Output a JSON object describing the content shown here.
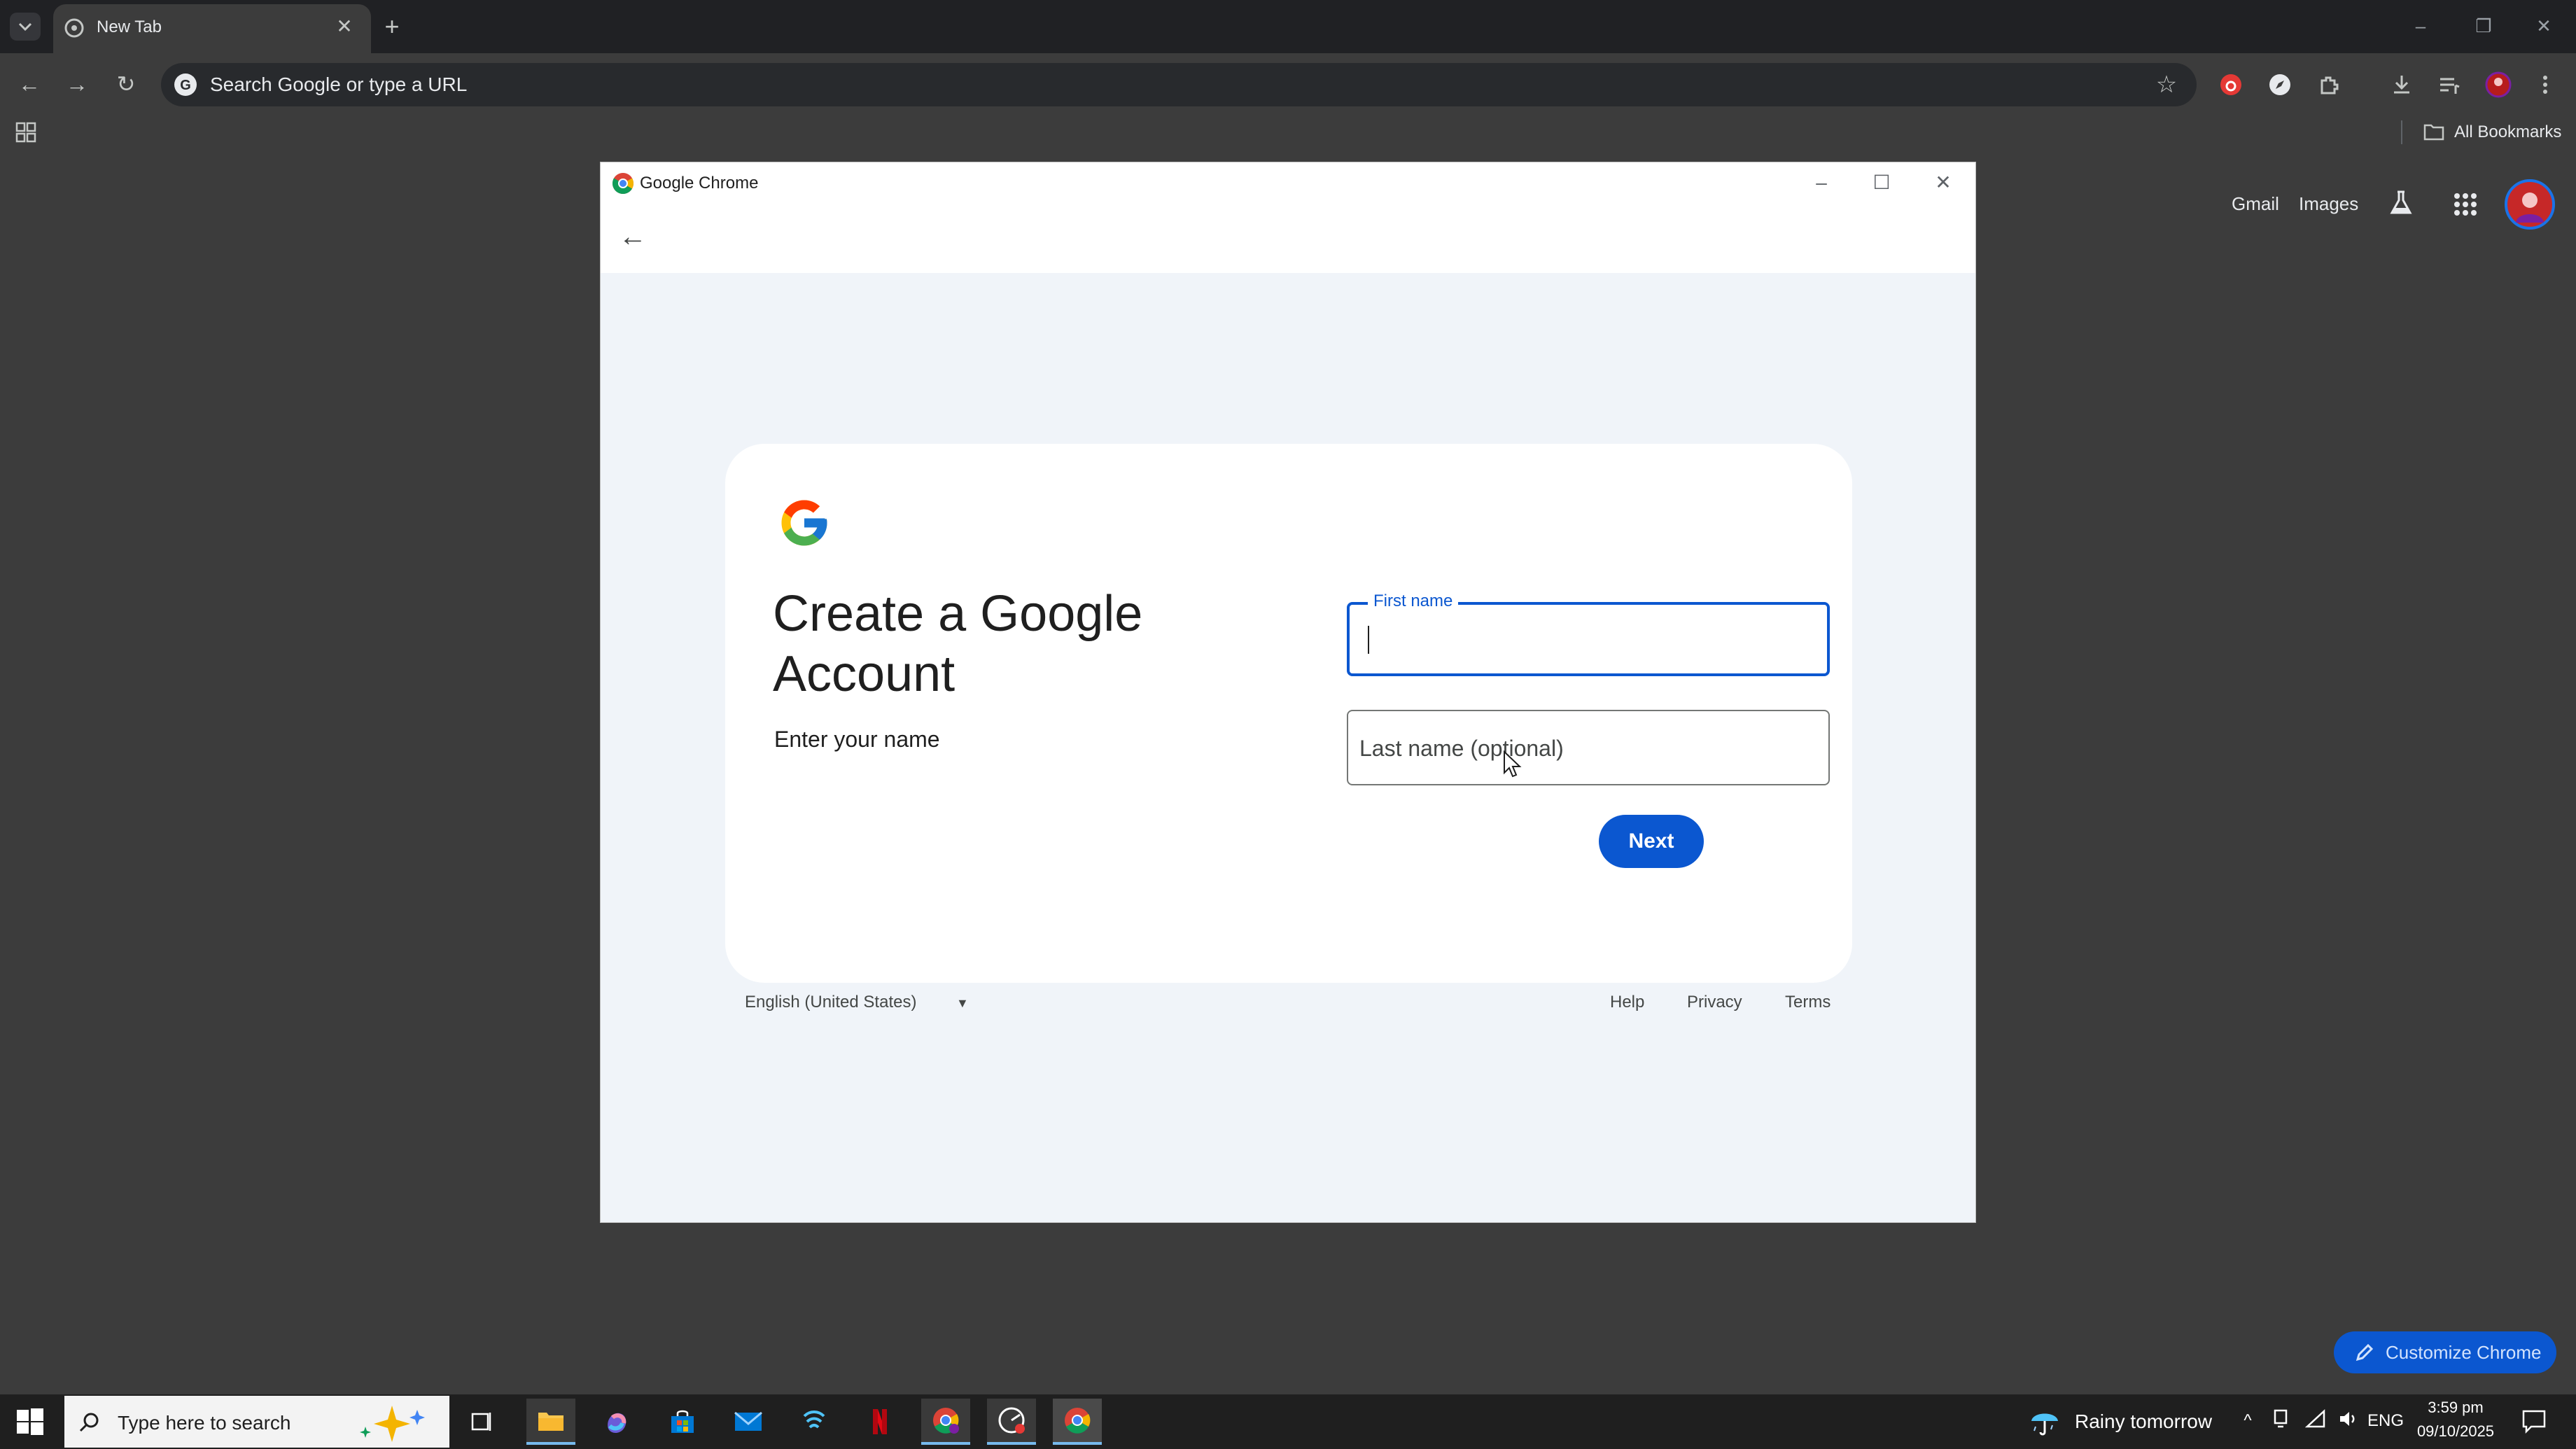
{
  "browser": {
    "tab": {
      "title": "New Tab",
      "close_glyph": "✕"
    },
    "new_tab_glyph": "+",
    "omnibox": {
      "placeholder": "Search Google or type a URL"
    },
    "bookmarks": {
      "all_bookmarks_label": "All Bookmarks"
    },
    "window_controls": {
      "minimize": "–",
      "restore": "❐",
      "close": "✕"
    }
  },
  "ntp": {
    "gmail_label": "Gmail",
    "images_label": "Images",
    "customize_label": "Customize Chrome"
  },
  "popup": {
    "title": "Google Chrome",
    "card": {
      "heading": "Create a Google Account",
      "subtitle": "Enter your name",
      "first_name": {
        "label": "First name",
        "value": ""
      },
      "last_name": {
        "placeholder": "Last name (optional)",
        "value": ""
      },
      "next_label": "Next"
    },
    "footer": {
      "language": "English (United States)",
      "help": "Help",
      "privacy": "Privacy",
      "terms": "Terms"
    }
  },
  "taskbar": {
    "search_placeholder": "Type here to search",
    "weather": "Rainy tomorrow",
    "language": "ENG",
    "time": "3:59 pm",
    "date": "09/10/2025",
    "apps": [
      "task-view",
      "file-explorer",
      "copilot",
      "microsoft-store",
      "mail",
      "vpn",
      "netflix",
      "chrome-profile",
      "chrome-alt",
      "chrome-active"
    ]
  },
  "colors": {
    "accent": "#0b57d0",
    "dark_bg": "#3c3c3c",
    "titlebar": "#202124",
    "card_bg": "#ffffff",
    "popup_bg": "#f0f4f9"
  }
}
